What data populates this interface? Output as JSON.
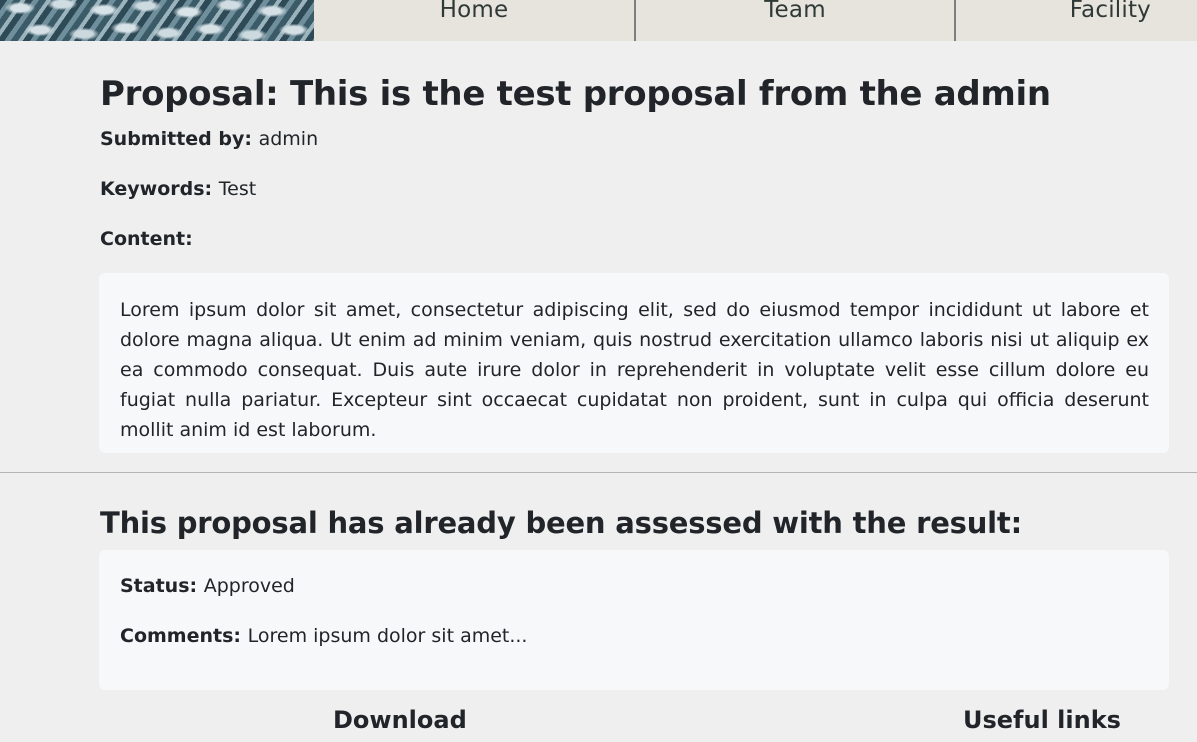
{
  "nav": {
    "items": [
      {
        "label": "Home"
      },
      {
        "label": "Team"
      },
      {
        "label": "Facility"
      }
    ]
  },
  "proposal": {
    "title": "Proposal: This is the test proposal from the admin",
    "submitted_label": "Submitted by:",
    "submitted_value": "admin",
    "keywords_label": "Keywords:",
    "keywords_value": "Test",
    "content_label": "Content:",
    "content_text": "Lorem ipsum dolor sit amet, consectetur adipiscing elit, sed do eiusmod tempor incididunt ut labore et dolore magna aliqua. Ut enim ad minim veniam, quis nostrud exercitation ullamco laboris nisi ut aliquip ex ea commodo consequat. Duis aute irure dolor in reprehenderit in voluptate velit esse cillum dolore eu fugiat nulla pariatur. Excepteur sint occaecat cupidatat non proident, sunt in culpa qui officia deserunt mollit anim id est laborum."
  },
  "assessment": {
    "heading": "This proposal has already been assessed with the result:",
    "status_label": "Status:",
    "status_value": "Approved",
    "comments_label": "Comments:",
    "comments_value": "Lorem ipsum dolor sit amet..."
  },
  "footer": {
    "download_heading": "Download",
    "links_heading": "Useful links"
  },
  "colors": {
    "page_background": "#efefef",
    "nav_background": "#e7e4dd",
    "box_background": "#f7f8fa",
    "text": "#212529"
  }
}
